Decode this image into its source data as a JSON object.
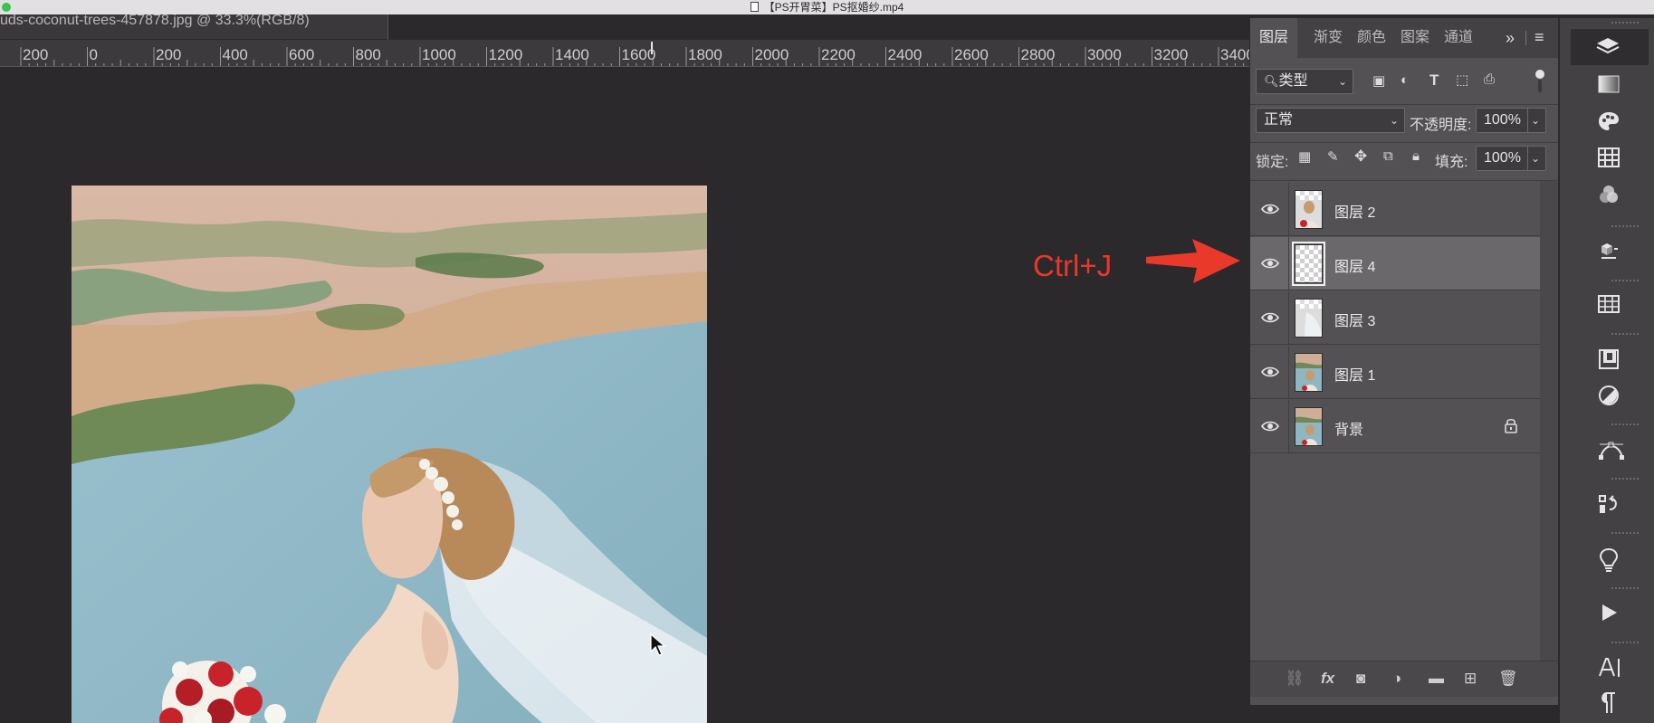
{
  "window": {
    "title": "【PS开胃菜】PS抠婚纱.mp4"
  },
  "document_tab": {
    "label": "uds-coconut-trees-457878.jpg @ 33.3%(RGB/8)"
  },
  "ruler": {
    "labels": [
      "200",
      "0",
      "200",
      "400",
      "600",
      "800",
      "1000",
      "1200",
      "1400",
      "1600",
      "1800",
      "2000",
      "2200",
      "2400",
      "2600",
      "2800",
      "3000",
      "3200",
      "3400"
    ]
  },
  "annotation": {
    "text": "Ctrl+J",
    "color": "#e8392a"
  },
  "layers_panel": {
    "tabs": [
      {
        "label": "图层",
        "active": true
      },
      {
        "label": "渐变",
        "active": false
      },
      {
        "label": "颜色",
        "active": false
      },
      {
        "label": "图案",
        "active": false
      },
      {
        "label": "通道",
        "active": false
      }
    ],
    "filter_type": "类型",
    "blend_mode": "正常",
    "opacity_label": "不透明度:",
    "opacity_value": "100%",
    "lock_label": "锁定:",
    "fill_label": "填充:",
    "fill_value": "100%",
    "layers": [
      {
        "name": "图层 2",
        "visible": true,
        "selected": false,
        "locked": false,
        "thumb": "cutout-bride"
      },
      {
        "name": "图层 4",
        "visible": true,
        "selected": true,
        "locked": false,
        "thumb": "transparent"
      },
      {
        "name": "图层 3",
        "visible": true,
        "selected": false,
        "locked": false,
        "thumb": "cutout-veil"
      },
      {
        "name": "图层 1",
        "visible": true,
        "selected": false,
        "locked": false,
        "thumb": "photo"
      },
      {
        "name": "背景",
        "visible": true,
        "selected": false,
        "locked": true,
        "thumb": "photo"
      }
    ]
  },
  "colors": {
    "accent_selected_layer": "#6a686a",
    "panel_bg": "#535153",
    "canvas_bg": "#2b292b",
    "annotation_red": "#e8392a"
  }
}
